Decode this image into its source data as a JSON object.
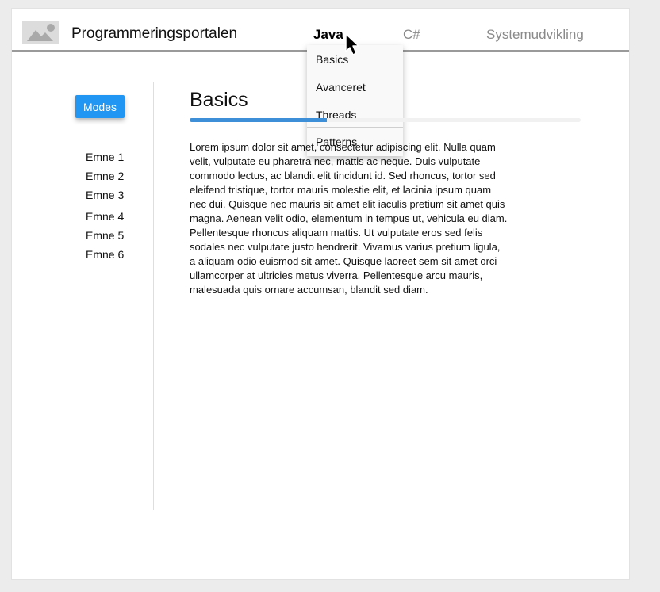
{
  "header": {
    "brand": "Programmeringsportalen",
    "logo_icon": "image-placeholder-icon",
    "nav": [
      {
        "label": "Java",
        "active": true
      },
      {
        "label": "C#",
        "active": false
      },
      {
        "label": "Systemudvikling",
        "active": false
      }
    ]
  },
  "dropdown": {
    "items": [
      {
        "label": "Basics"
      },
      {
        "label": "Avanceret"
      },
      {
        "label": "Threads"
      },
      {
        "label": "Patterns"
      }
    ]
  },
  "sidebar": {
    "modes_label": "Modes",
    "topics": [
      {
        "label": "Emne 1"
      },
      {
        "label": "Emne 2"
      },
      {
        "label": "Emne 3"
      },
      {
        "label": "Emne 4"
      },
      {
        "label": "Emne 5"
      },
      {
        "label": "Emne 6"
      }
    ]
  },
  "main": {
    "title": "Basics",
    "progress": 0.35,
    "body": "Lorem ipsum dolor sit amet, consectetur adipiscing elit. Nulla quam velit, vulputate eu pharetra nec, mattis ac neque. Duis vulputate commodo lectus, ac blandit elit tincidunt id. Sed rhoncus, tortor sed eleifend tristique, tortor mauris molestie elit, et lacinia ipsum quam nec dui. Quisque nec mauris sit amet elit iaculis pretium sit amet quis magna. Aenean velit odio, elementum in tempus ut, vehicula eu diam. Pellentesque rhoncus aliquam mattis. Ut vulputate eros sed felis sodales nec vulputate justo hendrerit. Vivamus varius pretium ligula, a aliquam odio euismod sit amet. Quisque laoreet sem sit amet orci ullamcorper at ultricies metus viverra. Pellentesque arcu mauris, malesuada quis ornare accumsan, blandit sed diam."
  },
  "colors": {
    "accent": "#2196f3",
    "progress": "#3d8fd8",
    "header_rule": "#9a9a9a",
    "inactive_nav": "#8a8a8a"
  }
}
